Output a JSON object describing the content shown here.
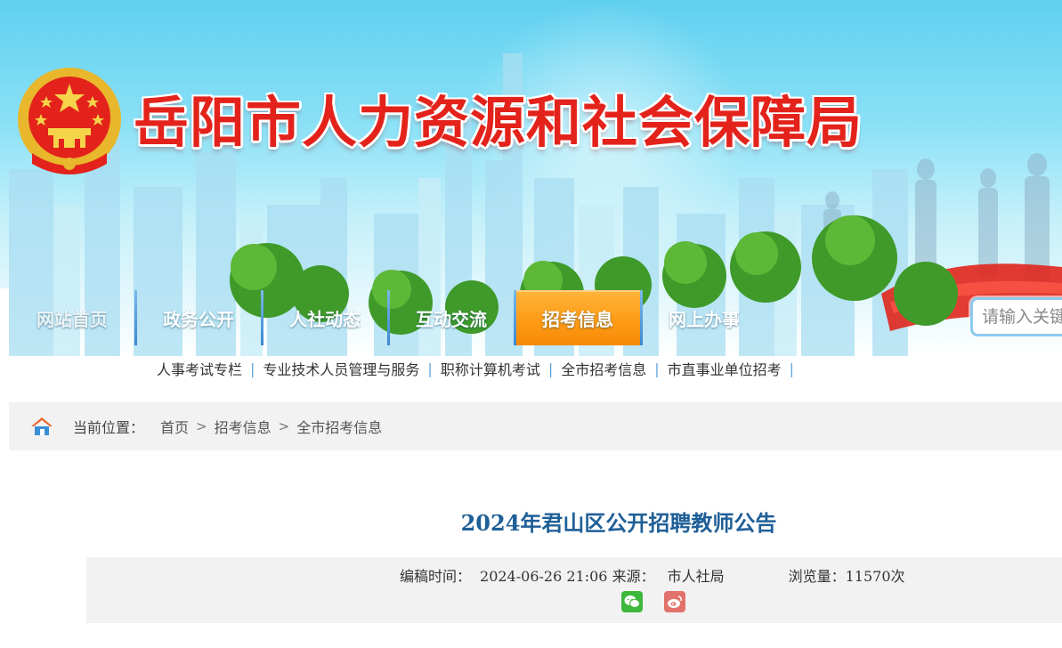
{
  "header": {
    "site_title": "岳阳市人力资源和社会保障局"
  },
  "nav": {
    "items": [
      {
        "label": "网站首页"
      },
      {
        "label": "政务公开"
      },
      {
        "label": "人社动态"
      },
      {
        "label": "互动交流"
      },
      {
        "label": "招考信息",
        "active": true
      },
      {
        "label": "网上办事"
      }
    ]
  },
  "search": {
    "placeholder": "请输入关键"
  },
  "subnav": {
    "items": [
      {
        "label": "人事考试专栏"
      },
      {
        "label": "专业技术人员管理与服务"
      },
      {
        "label": "职称计算机考试"
      },
      {
        "label": "全市招考信息"
      },
      {
        "label": "市直事业单位招考"
      }
    ],
    "separator": "|"
  },
  "breadcrumb": {
    "label": "当前位置：",
    "items": [
      {
        "label": "首页"
      },
      {
        "label": "招考信息"
      },
      {
        "label": "全市招考信息"
      }
    ],
    "separator": ">"
  },
  "article": {
    "title": "2024年君山区公开招聘教师公告",
    "meta": {
      "edit_time_label": "编稿时间：",
      "edit_time": "2024-06-26 21:06",
      "source_label": "来源：",
      "source": "市人社局",
      "views_label": "浏览量：",
      "views": "11570次"
    }
  },
  "colors": {
    "title_red": "#e3231b",
    "nav_active": "#ff9b16",
    "article_title": "#1f5f97",
    "wechat": "#3db83a",
    "weibo": "#e2726c"
  },
  "icons": {
    "emblem": "national-emblem-icon",
    "home": "home-icon",
    "wechat": "wechat-icon",
    "weibo": "weibo-icon"
  }
}
